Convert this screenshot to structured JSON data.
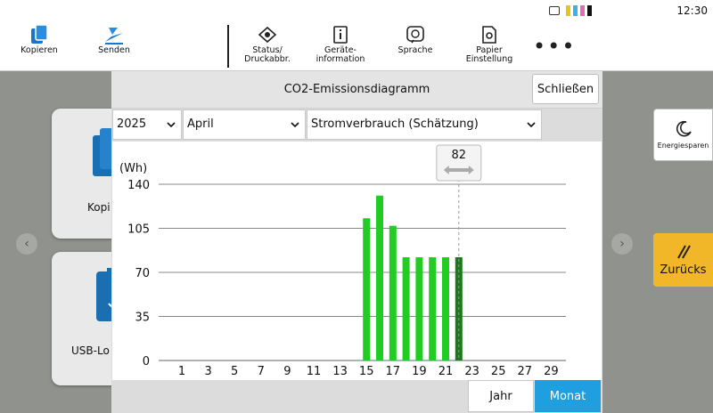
{
  "status": {
    "time": "12:30",
    "toner_colors": [
      "#e7c51a",
      "#3fb0e8",
      "#e36bb0",
      "#111111"
    ]
  },
  "toolbar": {
    "items": [
      {
        "label": "Kopieren",
        "icon": "copy-icon"
      },
      {
        "label": "Senden",
        "icon": "send-icon"
      },
      {
        "label": "Status/\nDruckabbr.",
        "icon": "status-icon"
      },
      {
        "label": "Geräte-\ninformation",
        "icon": "info-icon"
      },
      {
        "label": "Sprache",
        "icon": "language-icon"
      },
      {
        "label": "Papier\nEinstellung",
        "icon": "paper-settings-icon"
      }
    ],
    "more_label": "•••"
  },
  "home": {
    "tiles": [
      {
        "label": "Kopi"
      },
      {
        "label": "USB-Lo"
      }
    ]
  },
  "side": {
    "energy_label": "Energiesparen",
    "back_label": "Zurücks"
  },
  "dialog": {
    "title": "CO2-Emissionsdiagramm",
    "close_label": "Schließen",
    "year": "2025",
    "month": "April",
    "metric": "Stromverbrauch (Schätzung)",
    "footer": {
      "year_label": "Jahr",
      "month_label": "Monat"
    }
  },
  "chart_data": {
    "type": "bar",
    "ylabel": "(Wh)",
    "ylim": [
      0,
      140
    ],
    "yticks": [
      0,
      35,
      70,
      105,
      140
    ],
    "xticks": [
      1,
      3,
      5,
      7,
      9,
      11,
      13,
      15,
      17,
      19,
      21,
      23,
      25,
      27,
      29
    ],
    "x": [
      15,
      16,
      17,
      18,
      19,
      20,
      21,
      22
    ],
    "values": [
      113,
      131,
      107,
      82,
      82,
      82,
      82,
      82
    ],
    "selected_day": 22,
    "selected_value_label": "82",
    "colors": {
      "bar": "#22cc22",
      "selected": "#1a7a1a"
    }
  }
}
